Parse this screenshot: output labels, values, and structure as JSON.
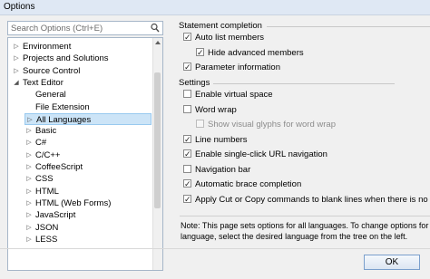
{
  "window": {
    "title": "Options"
  },
  "search": {
    "placeholder": "Search Options (Ctrl+E)"
  },
  "tree": {
    "items": [
      {
        "label": "Environment",
        "arrow": "▷",
        "level": 0
      },
      {
        "label": "Projects and Solutions",
        "arrow": "▷",
        "level": 0
      },
      {
        "label": "Source Control",
        "arrow": "▷",
        "level": 0
      },
      {
        "label": "Text Editor",
        "arrow": "◢",
        "level": 0
      },
      {
        "label": "General",
        "arrow": "",
        "level": 1
      },
      {
        "label": "File Extension",
        "arrow": "",
        "level": 1
      },
      {
        "label": "All Languages",
        "arrow": "▷",
        "level": 1,
        "selected": true
      },
      {
        "label": "Basic",
        "arrow": "▷",
        "level": 1
      },
      {
        "label": "C#",
        "arrow": "▷",
        "level": 1
      },
      {
        "label": "C/C++",
        "arrow": "▷",
        "level": 1
      },
      {
        "label": "CoffeeScript",
        "arrow": "▷",
        "level": 1
      },
      {
        "label": "CSS",
        "arrow": "▷",
        "level": 1
      },
      {
        "label": "HTML",
        "arrow": "▷",
        "level": 1
      },
      {
        "label": "HTML (Web Forms)",
        "arrow": "▷",
        "level": 1
      },
      {
        "label": "JavaScript",
        "arrow": "▷",
        "level": 1
      },
      {
        "label": "JSON",
        "arrow": "▷",
        "level": 1
      },
      {
        "label": "LESS",
        "arrow": "▷",
        "level": 1
      }
    ]
  },
  "statement_completion": {
    "title": "Statement completion",
    "options": [
      {
        "label": "Auto list members",
        "checked": true
      },
      {
        "label": "Hide advanced members",
        "checked": true,
        "indent": true
      },
      {
        "label": "Parameter information",
        "checked": true
      }
    ]
  },
  "settings": {
    "title": "Settings",
    "options": [
      {
        "label": "Enable virtual space",
        "checked": false
      },
      {
        "label": "Word wrap",
        "checked": false
      },
      {
        "label": "Show visual glyphs for word wrap",
        "checked": false,
        "indent": true,
        "disabled": true
      },
      {
        "label": "Line numbers",
        "checked": true
      },
      {
        "label": "Enable single-click URL navigation",
        "checked": true
      },
      {
        "label": "Navigation bar",
        "checked": false
      },
      {
        "label": "Automatic brace completion",
        "checked": true
      },
      {
        "label": "Apply Cut or Copy commands to blank lines when there is no selection",
        "checked": true
      }
    ]
  },
  "note": {
    "line1": "Note: This page sets options for all languages. To change options for only one",
    "line2": "language, select the desired language from the tree on the left."
  },
  "buttons": {
    "ok": "OK"
  }
}
